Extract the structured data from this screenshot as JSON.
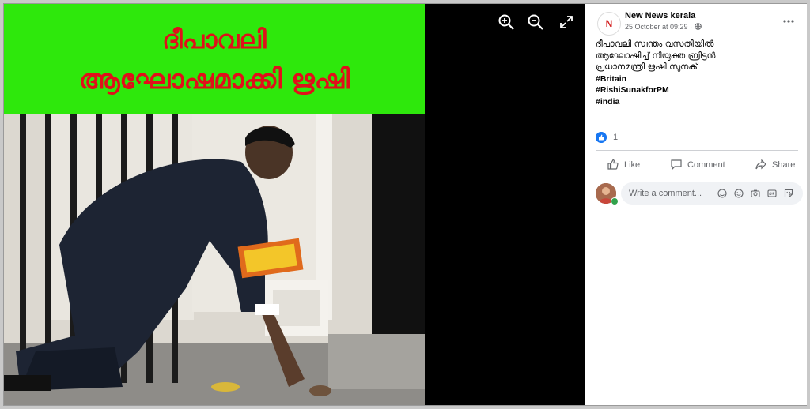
{
  "viewer": {
    "banner_line1": "ദീപാവലി",
    "banner_line2": "ആഘോഷമാക്കി ഋഷി",
    "tools": [
      "zoom-in-icon",
      "zoom-out-icon",
      "fullscreen-icon"
    ]
  },
  "post": {
    "avatar_letter": "N",
    "page_name": "New News kerala",
    "timestamp": "25 October at 09:29",
    "audience_separator": " · ",
    "caption_line1": "ദീപാവലി സ്വന്തം വസതിയിൽ",
    "caption_line2": "ആഘോഷിച്ച് നിയുക്ത ബ്രിട്ടൻ",
    "caption_line3": "പ്രധാനമന്ത്രി ഋഷി സുനക്",
    "hashtags": [
      "#Britain",
      "#RishiSunakforPM",
      "#india"
    ],
    "reaction_count": "1"
  },
  "actions": {
    "like": "Like",
    "comment": "Comment",
    "share": "Share"
  },
  "comment": {
    "placeholder": "Write a comment..."
  },
  "colors": {
    "banner_bg": "#2ee80c",
    "banner_text": "#e0101a",
    "facebook_blue": "#1877f2"
  }
}
